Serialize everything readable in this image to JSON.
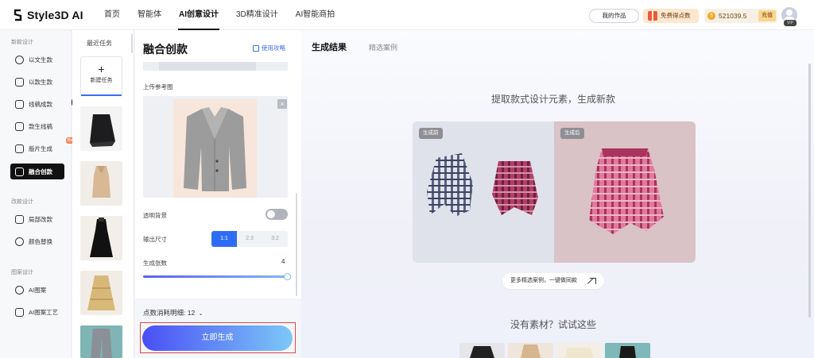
{
  "brand": {
    "name": "Style3D AI"
  },
  "nav": [
    "首页",
    "智能体",
    "AI创意设计",
    "3D精准设计",
    "AI智能商拍"
  ],
  "nav_active": 2,
  "topbar": {
    "works": "我的作品",
    "free_points": "免费得点数",
    "balance": "521039.5",
    "recharge": "充值",
    "vip": "VIP"
  },
  "sidebar": {
    "sections": [
      "新款设计",
      "改款设计",
      "图案设计"
    ],
    "items": [
      {
        "label": "以文生款",
        "icon": "text-to-style-icon"
      },
      {
        "label": "以款生款",
        "icon": "style-to-style-icon"
      },
      {
        "label": "线稿成款",
        "icon": "sketch-icon"
      },
      {
        "label": "款生线稿",
        "icon": "lineart-icon"
      },
      {
        "label": "版片生成",
        "icon": "pattern-piece-icon",
        "badge": "Beta"
      },
      {
        "label": "融合创款",
        "icon": "fusion-icon"
      },
      {
        "label": "局部改款",
        "icon": "partial-edit-icon"
      },
      {
        "label": "颜色替换",
        "icon": "color-replace-icon"
      },
      {
        "label": "AI图案",
        "icon": "ai-pattern-icon"
      },
      {
        "label": "AI图案工艺",
        "icon": "pattern-craft-icon"
      }
    ],
    "active": 5
  },
  "recent": {
    "title": "最近任务",
    "new_task": "新建任务",
    "thumbs": [
      "black-skirt",
      "beige-top",
      "black-dress",
      "khaki-skirt",
      "denim-pants"
    ]
  },
  "panel": {
    "title": "融合创款",
    "guide": "使用攻略",
    "upload_label": "上传参考图",
    "transparent_label": "透明背景",
    "transparent_on": false,
    "size_label": "输出尺寸",
    "sizes": [
      "1:1",
      "2:3",
      "3:2"
    ],
    "size_selected": 0,
    "count_label": "生成张数",
    "count_value": "4",
    "cost_label": "点数消耗明细: 12",
    "generate": "立即生成"
  },
  "main": {
    "tabs": [
      "生成结果",
      "精选案例"
    ],
    "headline": "提取款式设计元素，生成新款",
    "before_tag": "生成前",
    "after_tag": "生成后",
    "more": "更多精选案例，一键做同款",
    "no_material": "没有素材？试试这些"
  },
  "colors": {
    "accent": "#2f6cf6",
    "generate_start": "#4a4ff5",
    "generate_end": "#7cc8f7",
    "highlight": "#e0454b"
  }
}
